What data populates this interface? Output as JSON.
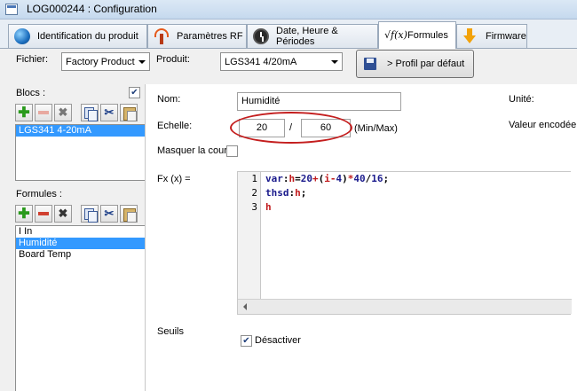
{
  "window": {
    "title": "LOG000244 : Configuration"
  },
  "tabs": [
    {
      "label": "Identification du produit",
      "icon": "globe-icon"
    },
    {
      "label": "Paramètres RF",
      "icon": "antenna-icon"
    },
    {
      "label": "Date, Heure & Périodes",
      "icon": "clock-icon"
    },
    {
      "label": "Formules",
      "icon": "sqrt-fx-icon",
      "glyph": "√f(x)",
      "active": true
    },
    {
      "label": "Firmware",
      "icon": "download-arrow-icon"
    }
  ],
  "top": {
    "fichier_label": "Fichier:",
    "fichier_value": "Factory Product",
    "produit_label": "Produit:",
    "produit_value": "LGS341 4/20mA",
    "profile_button": "> Profil par défaut"
  },
  "blocs": {
    "label": "Blocs :",
    "checked": true,
    "items": [
      {
        "label": "LGS341 4-20mA",
        "selected": true
      }
    ]
  },
  "formules": {
    "label": "Formules :",
    "items": [
      {
        "label": "I In",
        "selected": false
      },
      {
        "label": "Humidité",
        "selected": true
      },
      {
        "label": "Board Temp",
        "selected": false
      }
    ]
  },
  "detail": {
    "nom_label": "Nom:",
    "nom_value": "Humidité",
    "unite_label": "Unité:",
    "echelle_label": "Echelle:",
    "echelle_min": "20",
    "echelle_sep": "/",
    "echelle_max": "60",
    "echelle_hint": "(Min/Max)",
    "valeur_label": "Valeur encodée",
    "masquer_label": "Masquer la courbe",
    "masquer_checked": false,
    "fx_label": "Fx (x) =",
    "code_lines": [
      "1",
      "2",
      "3"
    ],
    "seuils_label": "Seuils",
    "desactiver_label": "Désactiver",
    "desactiver_checked": true
  },
  "colors": {
    "selection": "#3399ff",
    "highlight_ellipse": "#c41e1e",
    "code_keyword": "#1a1a8c",
    "code_variable": "#c0181a"
  }
}
